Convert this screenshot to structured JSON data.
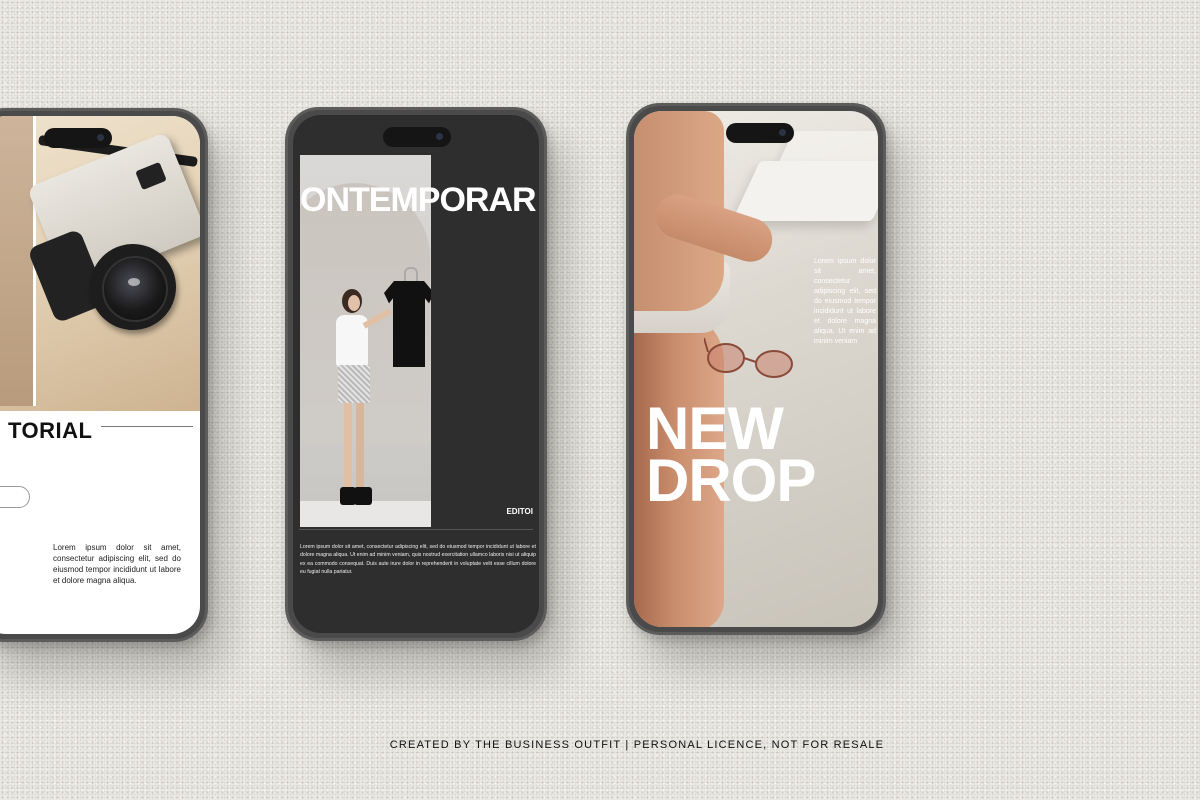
{
  "phones": {
    "left": {
      "title": "TORIAL",
      "body": "Lorem ipsum dolor sit amet, consectetur adipiscing elit, sed do eiusmod tempor incididunt ut labore et dolore magna aliqua."
    },
    "middle": {
      "headline": "ONTEMPORAR",
      "label": "EDITOI",
      "body": "Lorem ipsum dolor sit amet, consectetur adipiscing elit, sed do eiusmod tempor incididunt ut labore et dolore magna aliqua. Ut enim ad minim veniam, quis nostrud exercitation ullamco laboris nisi ut aliquip ex ea commodo consequat. Duis aute irure dolor in reprehenderit in voluptate velit esse cillum dolore eu fugiat nulla pariatur."
    },
    "right": {
      "headline_line1": "NEW",
      "headline_line2": "DROP",
      "body": "Lorem ipsum dolor sit amet, consectetur adipiscing elit, sed do eiusmod tempor incididunt ut labore et dolore magna aliqua. Ut enim ad minim veniam"
    }
  },
  "footer": {
    "credit": "CREATED BY THE BUSINESS OUTFIT | PERSONAL LICENCE, NOT FOR RESALE"
  }
}
